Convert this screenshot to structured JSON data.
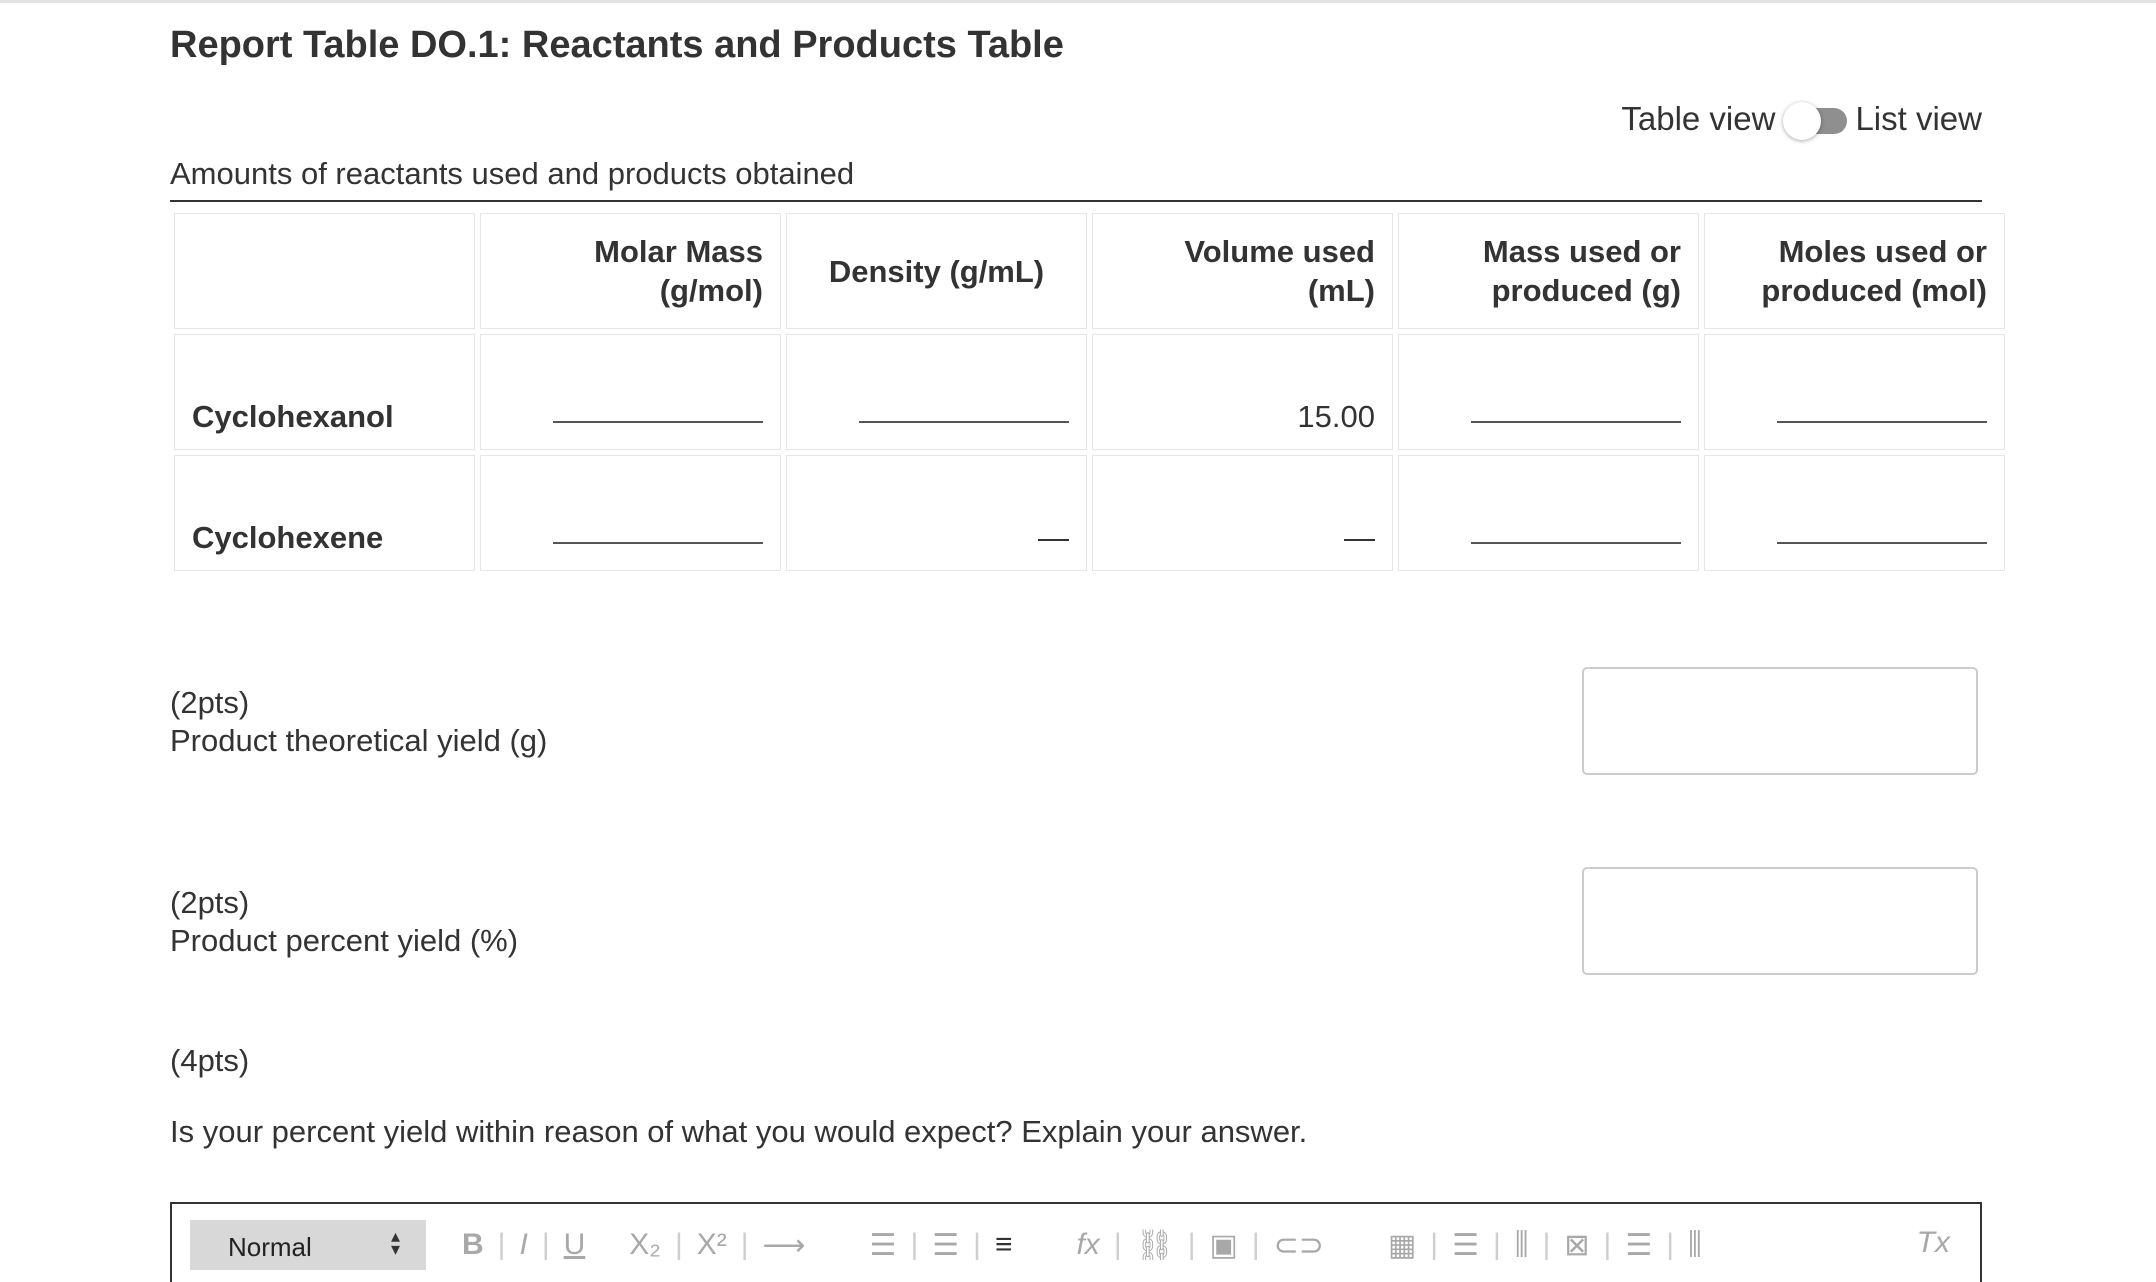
{
  "title": "Report Table DO.1: Reactants and Products Table",
  "view_toggle": {
    "left_label": "Table view",
    "right_label": "List view"
  },
  "table": {
    "caption": "Amounts of reactants used and products obtained",
    "headers": {
      "blank": "",
      "molar_mass": [
        "Molar Mass",
        "(g/mol)"
      ],
      "density": "Density (g/mL)",
      "volume": [
        "Volume used",
        "(mL)"
      ],
      "mass": [
        "Mass used or",
        "produced (g)"
      ],
      "moles": [
        "Moles used or",
        "produced (mol)"
      ]
    },
    "rows": [
      {
        "name": "Cyclohexanol",
        "volume_value": "15.00"
      },
      {
        "name": "Cyclohexene",
        "density_value": "—",
        "volume_value": "—"
      }
    ]
  },
  "questions": [
    {
      "points": "(2pts)",
      "label": "Product theoretical yield (g)"
    },
    {
      "points": "(2pts)",
      "label": "Product percent yield (%)"
    },
    {
      "points": "(4pts)",
      "label": "Is your percent yield within reason of what you would expect? Explain your answer."
    }
  ],
  "editor": {
    "format_select": "Normal",
    "tools": [
      "B",
      "I",
      "U",
      "X₂",
      "X²",
      "⟶",
      "ordered-list-icon",
      "bullet-list-icon",
      "align-icon",
      "formula-icon",
      "link-icon",
      "image-icon",
      "embed-icon",
      "table-icon",
      "insert-row-icon",
      "insert-column-icon",
      "delete-table-icon",
      "delete-row-icon",
      "delete-column-icon",
      "clear-format-icon"
    ],
    "labels": {
      "bold": "B",
      "italic": "I",
      "underline": "U",
      "subscript": "X₂",
      "superscript": "X²",
      "arrow": "⟶",
      "formula": "fx",
      "clear": "Tx"
    }
  },
  "colors": {
    "text": "#333333",
    "border_light": "#e6e6e6",
    "toggle_track": "#8f8f8f",
    "toolbar_icon": "#a8a8a8"
  }
}
